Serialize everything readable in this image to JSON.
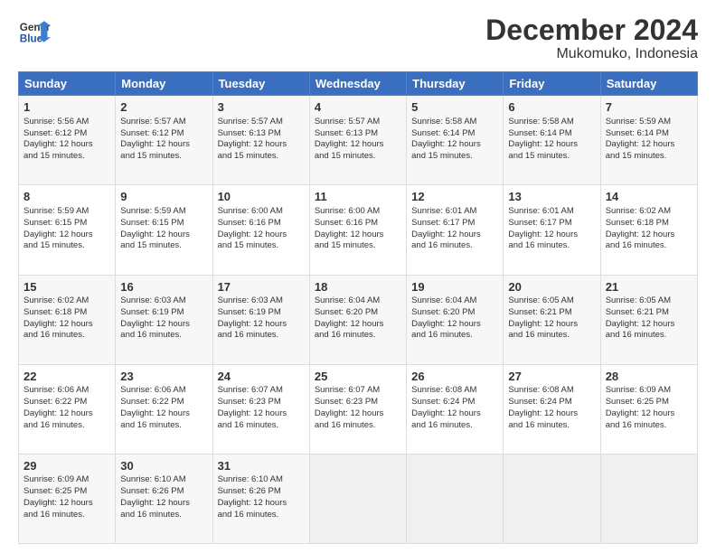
{
  "header": {
    "logo_line1": "General",
    "logo_line2": "Blue",
    "title": "December 2024",
    "subtitle": "Mukomuko, Indonesia"
  },
  "days_of_week": [
    "Sunday",
    "Monday",
    "Tuesday",
    "Wednesday",
    "Thursday",
    "Friday",
    "Saturday"
  ],
  "weeks": [
    [
      {
        "day": 1,
        "lines": [
          "Sunrise: 5:56 AM",
          "Sunset: 6:12 PM",
          "Daylight: 12 hours",
          "and 15 minutes."
        ]
      },
      {
        "day": 2,
        "lines": [
          "Sunrise: 5:57 AM",
          "Sunset: 6:12 PM",
          "Daylight: 12 hours",
          "and 15 minutes."
        ]
      },
      {
        "day": 3,
        "lines": [
          "Sunrise: 5:57 AM",
          "Sunset: 6:13 PM",
          "Daylight: 12 hours",
          "and 15 minutes."
        ]
      },
      {
        "day": 4,
        "lines": [
          "Sunrise: 5:57 AM",
          "Sunset: 6:13 PM",
          "Daylight: 12 hours",
          "and 15 minutes."
        ]
      },
      {
        "day": 5,
        "lines": [
          "Sunrise: 5:58 AM",
          "Sunset: 6:14 PM",
          "Daylight: 12 hours",
          "and 15 minutes."
        ]
      },
      {
        "day": 6,
        "lines": [
          "Sunrise: 5:58 AM",
          "Sunset: 6:14 PM",
          "Daylight: 12 hours",
          "and 15 minutes."
        ]
      },
      {
        "day": 7,
        "lines": [
          "Sunrise: 5:59 AM",
          "Sunset: 6:14 PM",
          "Daylight: 12 hours",
          "and 15 minutes."
        ]
      }
    ],
    [
      {
        "day": 8,
        "lines": [
          "Sunrise: 5:59 AM",
          "Sunset: 6:15 PM",
          "Daylight: 12 hours",
          "and 15 minutes."
        ]
      },
      {
        "day": 9,
        "lines": [
          "Sunrise: 5:59 AM",
          "Sunset: 6:15 PM",
          "Daylight: 12 hours",
          "and 15 minutes."
        ]
      },
      {
        "day": 10,
        "lines": [
          "Sunrise: 6:00 AM",
          "Sunset: 6:16 PM",
          "Daylight: 12 hours",
          "and 15 minutes."
        ]
      },
      {
        "day": 11,
        "lines": [
          "Sunrise: 6:00 AM",
          "Sunset: 6:16 PM",
          "Daylight: 12 hours",
          "and 15 minutes."
        ]
      },
      {
        "day": 12,
        "lines": [
          "Sunrise: 6:01 AM",
          "Sunset: 6:17 PM",
          "Daylight: 12 hours",
          "and 16 minutes."
        ]
      },
      {
        "day": 13,
        "lines": [
          "Sunrise: 6:01 AM",
          "Sunset: 6:17 PM",
          "Daylight: 12 hours",
          "and 16 minutes."
        ]
      },
      {
        "day": 14,
        "lines": [
          "Sunrise: 6:02 AM",
          "Sunset: 6:18 PM",
          "Daylight: 12 hours",
          "and 16 minutes."
        ]
      }
    ],
    [
      {
        "day": 15,
        "lines": [
          "Sunrise: 6:02 AM",
          "Sunset: 6:18 PM",
          "Daylight: 12 hours",
          "and 16 minutes."
        ]
      },
      {
        "day": 16,
        "lines": [
          "Sunrise: 6:03 AM",
          "Sunset: 6:19 PM",
          "Daylight: 12 hours",
          "and 16 minutes."
        ]
      },
      {
        "day": 17,
        "lines": [
          "Sunrise: 6:03 AM",
          "Sunset: 6:19 PM",
          "Daylight: 12 hours",
          "and 16 minutes."
        ]
      },
      {
        "day": 18,
        "lines": [
          "Sunrise: 6:04 AM",
          "Sunset: 6:20 PM",
          "Daylight: 12 hours",
          "and 16 minutes."
        ]
      },
      {
        "day": 19,
        "lines": [
          "Sunrise: 6:04 AM",
          "Sunset: 6:20 PM",
          "Daylight: 12 hours",
          "and 16 minutes."
        ]
      },
      {
        "day": 20,
        "lines": [
          "Sunrise: 6:05 AM",
          "Sunset: 6:21 PM",
          "Daylight: 12 hours",
          "and 16 minutes."
        ]
      },
      {
        "day": 21,
        "lines": [
          "Sunrise: 6:05 AM",
          "Sunset: 6:21 PM",
          "Daylight: 12 hours",
          "and 16 minutes."
        ]
      }
    ],
    [
      {
        "day": 22,
        "lines": [
          "Sunrise: 6:06 AM",
          "Sunset: 6:22 PM",
          "Daylight: 12 hours",
          "and 16 minutes."
        ]
      },
      {
        "day": 23,
        "lines": [
          "Sunrise: 6:06 AM",
          "Sunset: 6:22 PM",
          "Daylight: 12 hours",
          "and 16 minutes."
        ]
      },
      {
        "day": 24,
        "lines": [
          "Sunrise: 6:07 AM",
          "Sunset: 6:23 PM",
          "Daylight: 12 hours",
          "and 16 minutes."
        ]
      },
      {
        "day": 25,
        "lines": [
          "Sunrise: 6:07 AM",
          "Sunset: 6:23 PM",
          "Daylight: 12 hours",
          "and 16 minutes."
        ]
      },
      {
        "day": 26,
        "lines": [
          "Sunrise: 6:08 AM",
          "Sunset: 6:24 PM",
          "Daylight: 12 hours",
          "and 16 minutes."
        ]
      },
      {
        "day": 27,
        "lines": [
          "Sunrise: 6:08 AM",
          "Sunset: 6:24 PM",
          "Daylight: 12 hours",
          "and 16 minutes."
        ]
      },
      {
        "day": 28,
        "lines": [
          "Sunrise: 6:09 AM",
          "Sunset: 6:25 PM",
          "Daylight: 12 hours",
          "and 16 minutes."
        ]
      }
    ],
    [
      {
        "day": 29,
        "lines": [
          "Sunrise: 6:09 AM",
          "Sunset: 6:25 PM",
          "Daylight: 12 hours",
          "and 16 minutes."
        ]
      },
      {
        "day": 30,
        "lines": [
          "Sunrise: 6:10 AM",
          "Sunset: 6:26 PM",
          "Daylight: 12 hours",
          "and 16 minutes."
        ]
      },
      {
        "day": 31,
        "lines": [
          "Sunrise: 6:10 AM",
          "Sunset: 6:26 PM",
          "Daylight: 12 hours",
          "and 16 minutes."
        ]
      },
      null,
      null,
      null,
      null
    ]
  ]
}
